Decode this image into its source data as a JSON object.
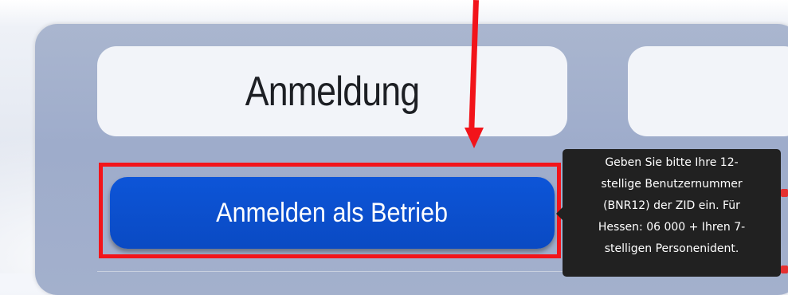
{
  "card": {
    "title": "Anmeldung"
  },
  "login": {
    "button_label": "Anmelden als Betrieb"
  },
  "tooltip": {
    "lines": [
      "Geben Sie bitte Ihre 12-",
      "stellige Benutzernummer",
      "(BNR12) der ZID ein. Für",
      "Hessen: 06 000 + Ihren 7-",
      "stelligen Personenident."
    ]
  },
  "colors": {
    "button": "#0a4ac3",
    "annotation": "#f2141a",
    "tooltip_bg": "#212121",
    "panel": "#a3b0cc"
  },
  "icons": {
    "pointer": "arrow-down-icon"
  }
}
